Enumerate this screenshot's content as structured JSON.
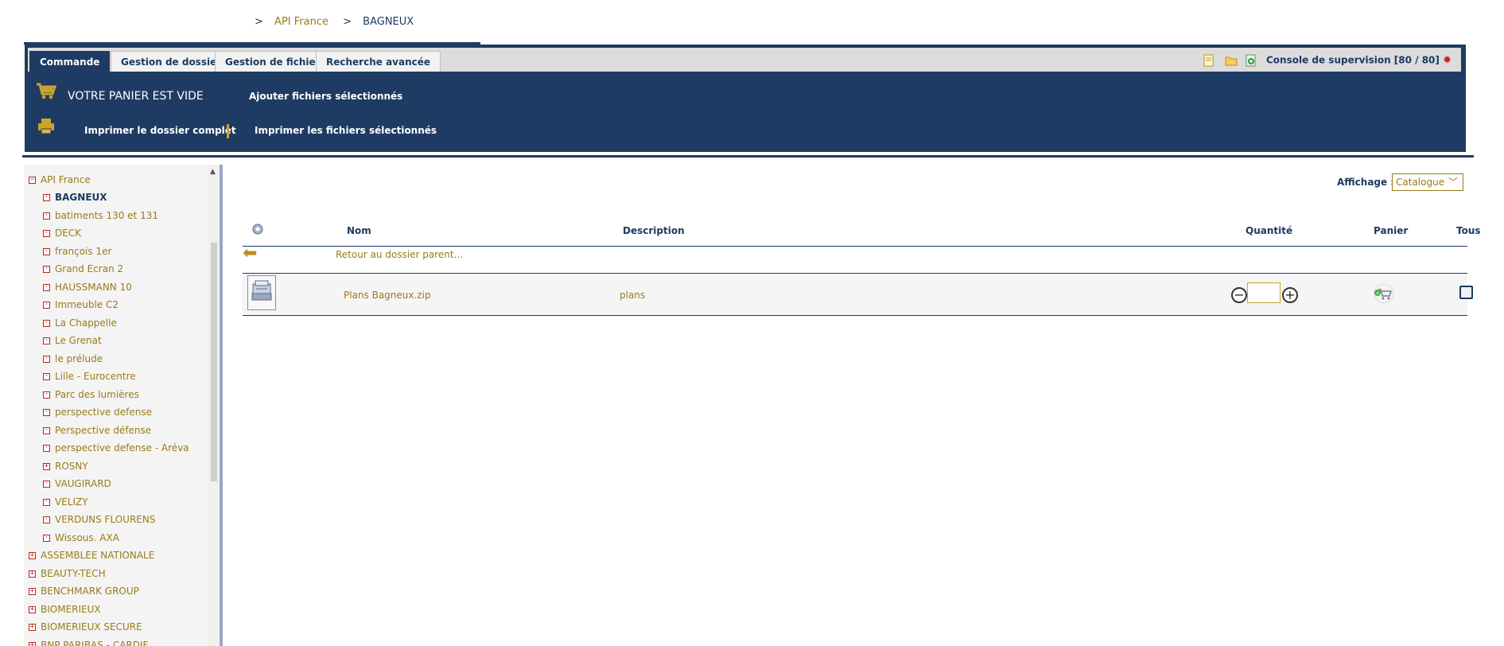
{
  "breadcrumb": {
    "separator": ">",
    "items": [
      "API France",
      "BAGNEUX"
    ]
  },
  "tabs": [
    {
      "label": "Commande",
      "active": true
    },
    {
      "label": "Gestion de dossier",
      "active": false
    },
    {
      "label": "Gestion de fichier",
      "active": false
    },
    {
      "label": "Recherche avancée",
      "active": false
    }
  ],
  "console": {
    "label": "Console de supervision [80 / 80]"
  },
  "cart": {
    "status": "VOTRE PANIER EST VIDE",
    "add_selected": "Ajouter fichiers sélectionnés"
  },
  "print": {
    "full": "Imprimer le dossier complet",
    "selected": "Imprimer les fichiers sélectionnés"
  },
  "tree": {
    "root": "API France",
    "children": [
      {
        "label": "BAGNEUX",
        "sign": "-",
        "current": true
      },
      {
        "label": "batiments 130 et 131",
        "sign": "-"
      },
      {
        "label": "DECK",
        "sign": "-"
      },
      {
        "label": "françois 1er",
        "sign": "-"
      },
      {
        "label": "Grand Ecran 2",
        "sign": "-"
      },
      {
        "label": "HAUSSMANN 10",
        "sign": "-"
      },
      {
        "label": "Immeuble C2",
        "sign": "-"
      },
      {
        "label": "La Chappelle",
        "sign": "-"
      },
      {
        "label": "Le Grenat",
        "sign": "-"
      },
      {
        "label": "le prélude",
        "sign": "-"
      },
      {
        "label": "Lille - Eurocentre",
        "sign": "-"
      },
      {
        "label": "Parc des lumières",
        "sign": "-"
      },
      {
        "label": "perspective defense",
        "sign": "-"
      },
      {
        "label": "Perspective défense",
        "sign": "-"
      },
      {
        "label": "perspective defense - Aréva",
        "sign": "-"
      },
      {
        "label": "ROSNY",
        "sign": "+"
      },
      {
        "label": "VAUGIRARD",
        "sign": "-"
      },
      {
        "label": "VELIZY",
        "sign": "-"
      },
      {
        "label": "VERDUNS FLOURENS",
        "sign": "-"
      },
      {
        "label": "Wissous. AXA",
        "sign": "-"
      }
    ],
    "others": [
      "ASSEMBLEE NATIONALE",
      "BEAUTY-TECH",
      "BENCHMARK GROUP",
      "BIOMERIEUX",
      "BIOMERIEUX SECURE",
      "BNP PARIBAS - CARDIF"
    ]
  },
  "affichage": {
    "label": "Affichage :",
    "value": "Catalogue"
  },
  "table": {
    "headers": {
      "nom": "Nom",
      "description": "Description",
      "quantite": "Quantité",
      "panier": "Panier",
      "tous": "Tous"
    },
    "parent_link": "Retour au dossier parent...",
    "rows": [
      {
        "nom": "Plans Bagneux.zip",
        "description": "plans"
      }
    ]
  },
  "colors": {
    "navy": "#1e3b63",
    "gold": "#9a7b18",
    "accent": "#c9a52a"
  }
}
